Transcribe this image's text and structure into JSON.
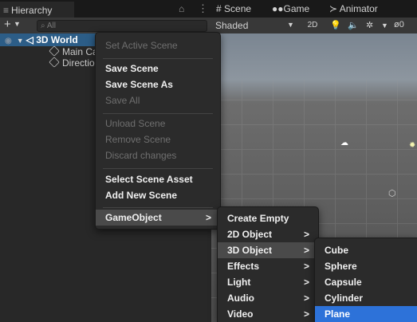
{
  "hierarchy": {
    "tab_label": "Hierarchy",
    "search_placeholder": "All",
    "tree": {
      "scene_name": "3D World",
      "children": [
        "Main Ca",
        "Directio"
      ]
    }
  },
  "scene_view": {
    "tabs": [
      "Scene",
      "Game",
      "Animator"
    ],
    "shading_mode": "Shaded",
    "toggle_2d": "2D",
    "hidden_count": "0"
  },
  "context_menu": {
    "items": [
      {
        "label": "Set Active Scene",
        "enabled": false
      },
      {
        "label": "Save Scene",
        "enabled": true
      },
      {
        "label": "Save Scene As",
        "enabled": true
      },
      {
        "label": "Save All",
        "enabled": false
      },
      {
        "label": "Unload Scene",
        "enabled": false
      },
      {
        "label": "Remove Scene",
        "enabled": false
      },
      {
        "label": "Discard changes",
        "enabled": false
      },
      {
        "label": "Select Scene Asset",
        "enabled": true
      },
      {
        "label": "Add New Scene",
        "enabled": true
      },
      {
        "label": "GameObject",
        "enabled": true,
        "has_submenu": true
      }
    ]
  },
  "gameobject_menu": {
    "items": [
      {
        "label": "Create Empty",
        "has_submenu": false
      },
      {
        "label": "2D Object",
        "has_submenu": true
      },
      {
        "label": "3D Object",
        "has_submenu": true
      },
      {
        "label": "Effects",
        "has_submenu": true
      },
      {
        "label": "Light",
        "has_submenu": true
      },
      {
        "label": "Audio",
        "has_submenu": true
      },
      {
        "label": "Video",
        "has_submenu": true
      }
    ]
  },
  "object_3d_menu": {
    "items": [
      "Cube",
      "Sphere",
      "Capsule",
      "Cylinder",
      "Plane"
    ],
    "selected": "Plane"
  },
  "colors": {
    "selection_blue": "#2d72d9",
    "tree_selection": "#2c5d87",
    "menu_background": "#2b2b2b",
    "disabled_text": "#6f6f6f"
  },
  "icons": {
    "submenu_arrow": "chevron-right-icon",
    "lock": "lock-icon",
    "more": "kebab-menu-icon"
  }
}
